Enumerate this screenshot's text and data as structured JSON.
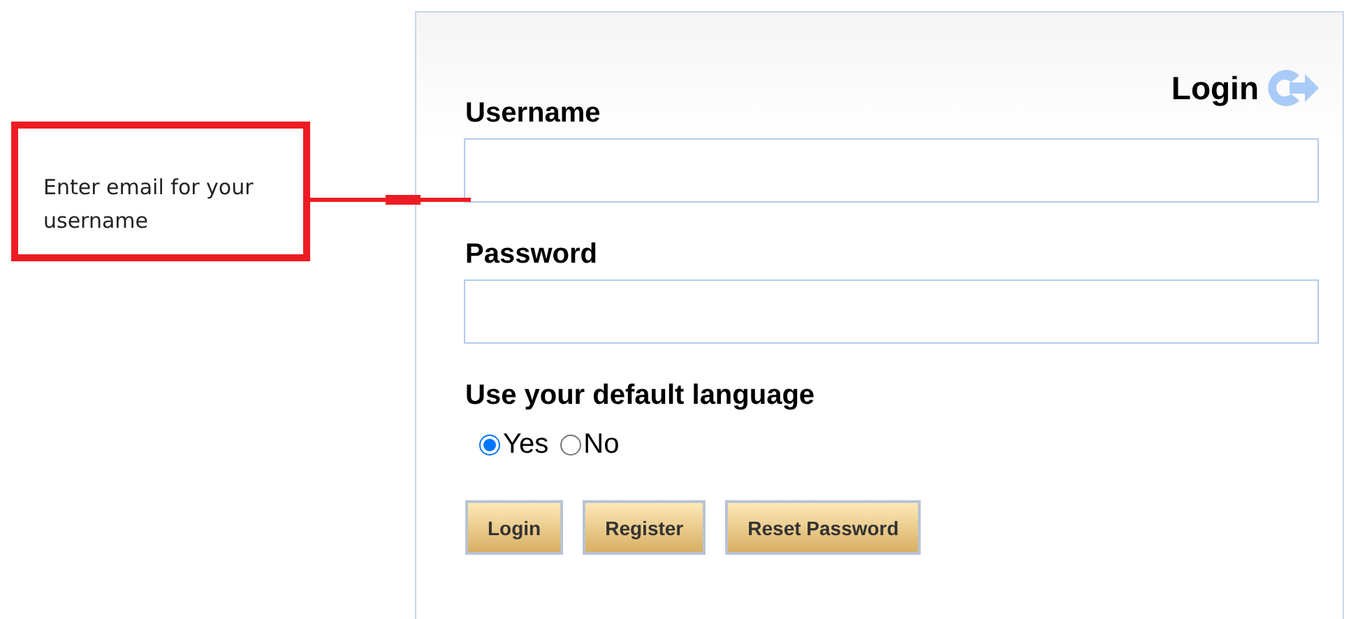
{
  "callout": {
    "text": "Enter email for your username"
  },
  "header": {
    "title": "Login"
  },
  "fields": [
    {
      "label": "Username"
    },
    {
      "label": "Password"
    }
  ],
  "language": {
    "label": "Use your default language",
    "options": [
      {
        "label": "Yes",
        "selected": true
      },
      {
        "label": "No",
        "selected": false
      }
    ]
  },
  "buttons": [
    "Login",
    "Register",
    "Reset Password"
  ]
}
